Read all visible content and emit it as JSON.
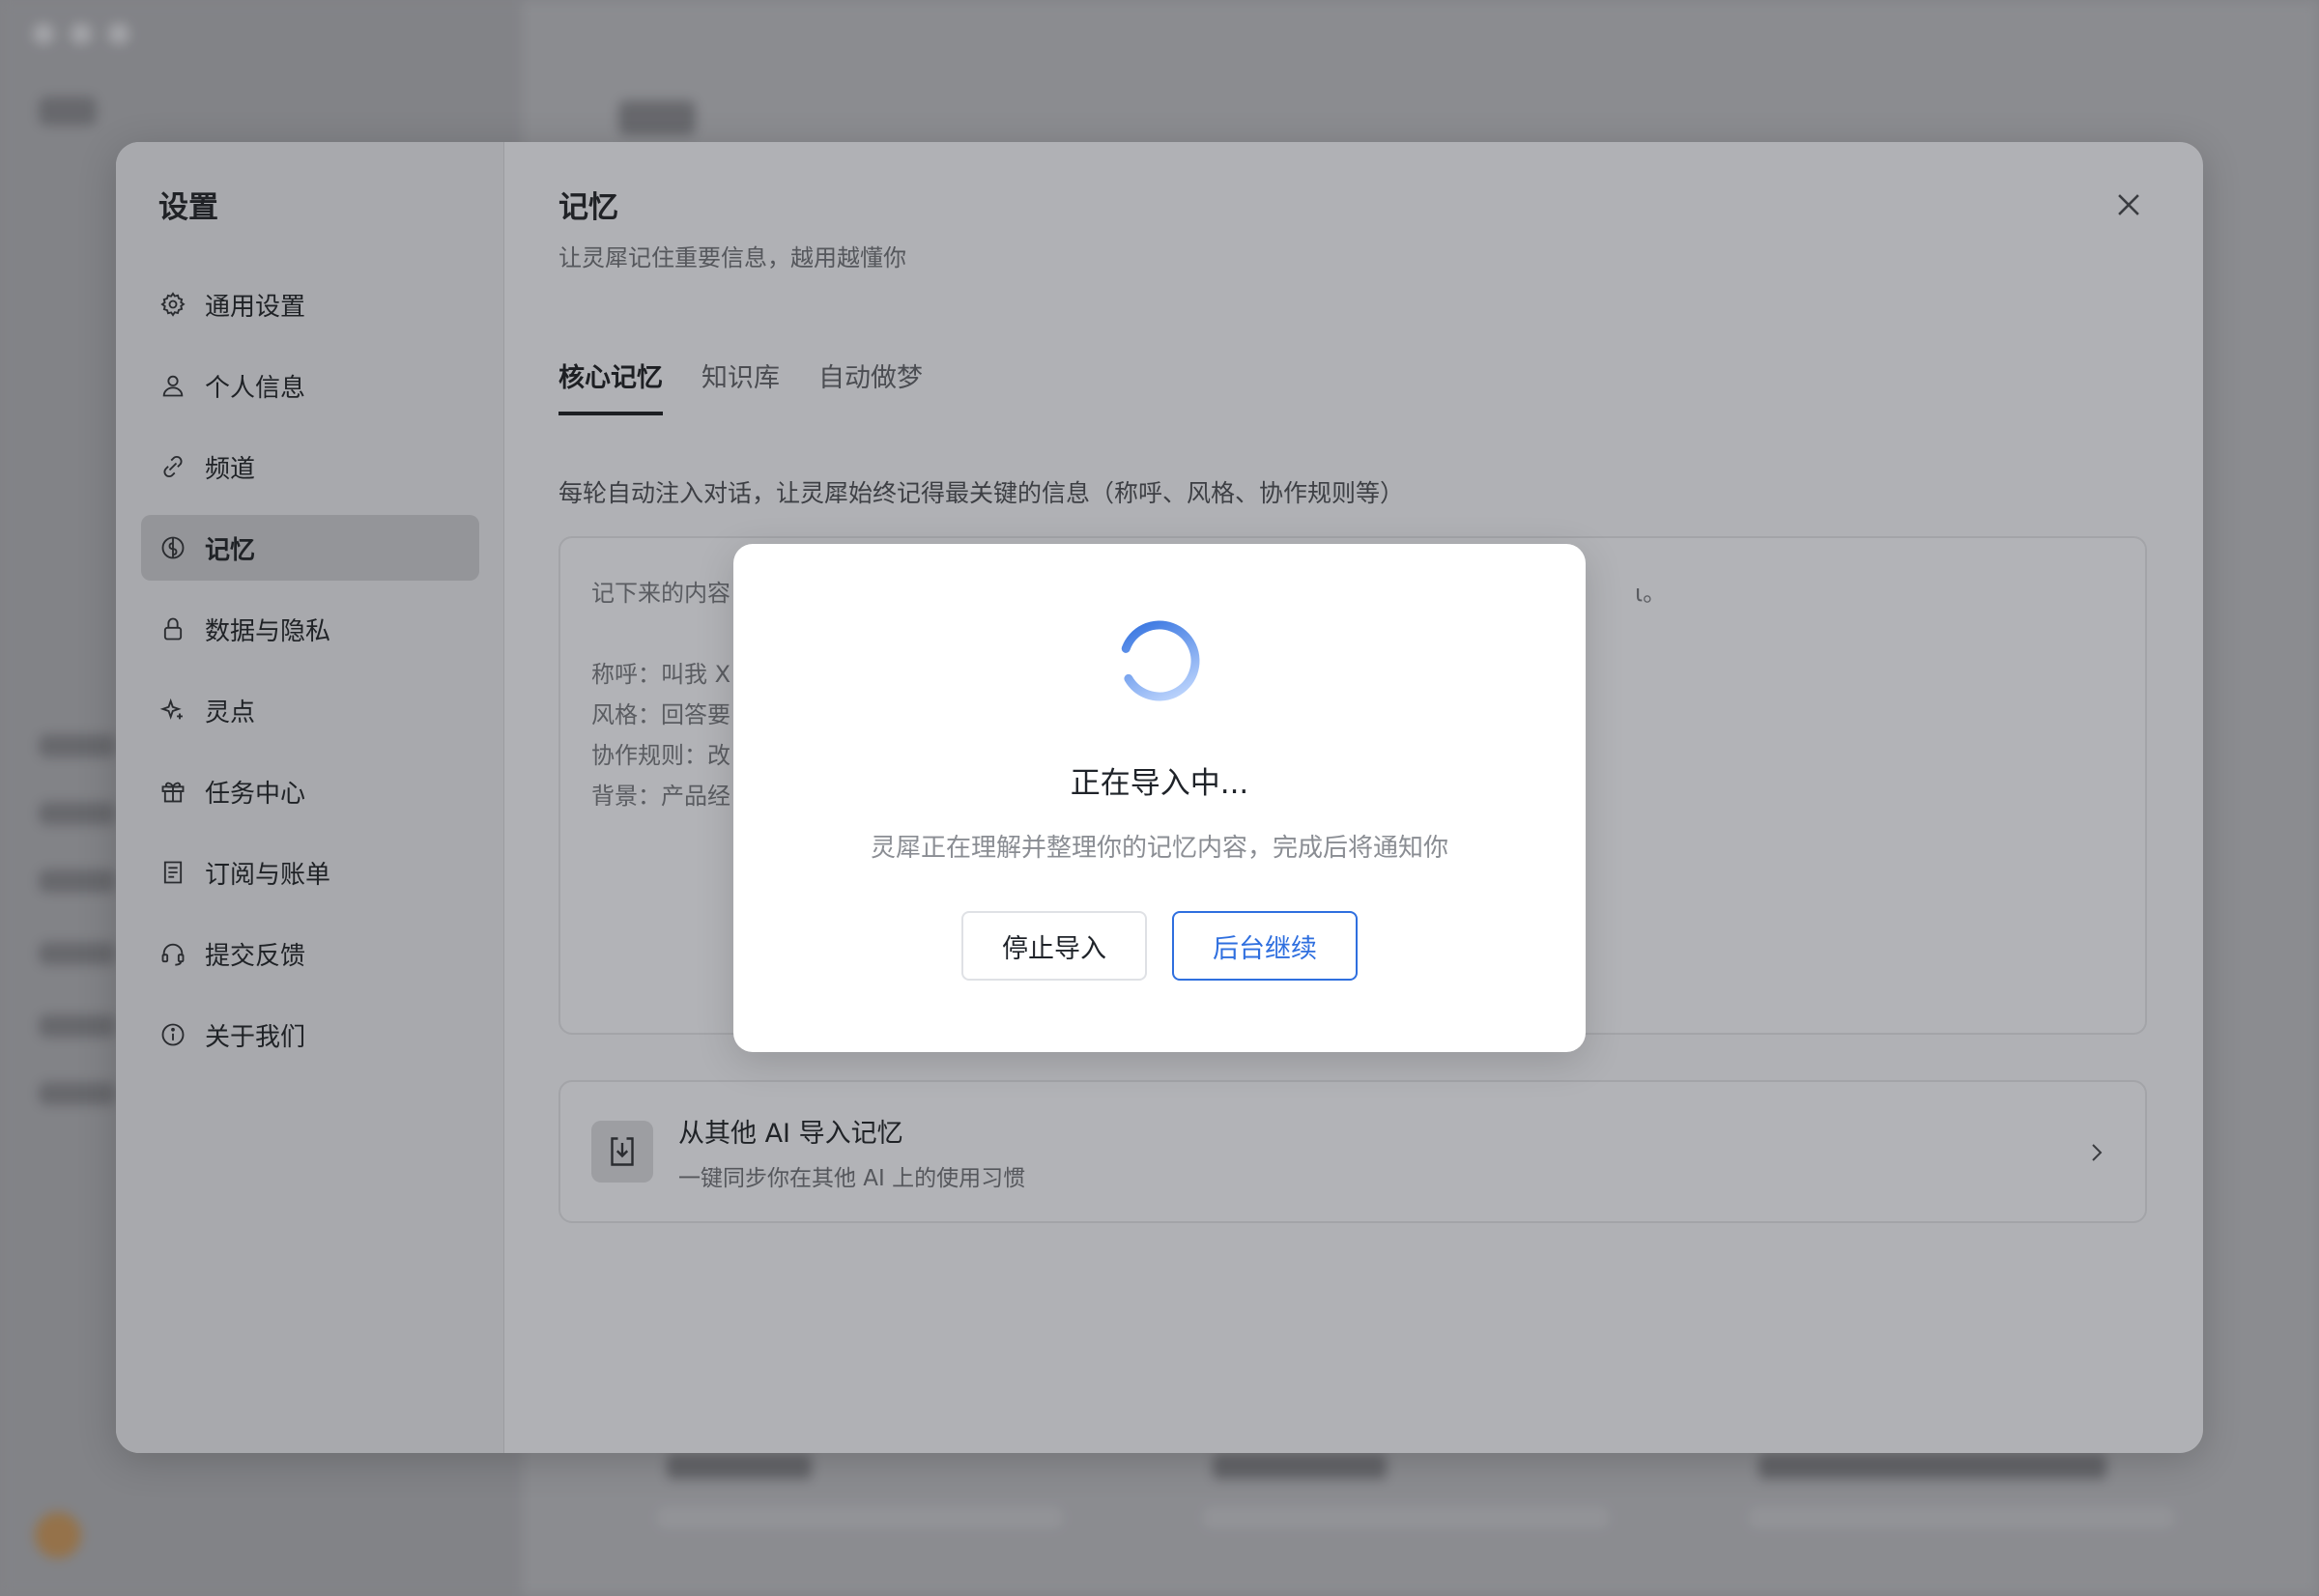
{
  "settings": {
    "title": "设置",
    "nav": [
      {
        "label": "通用设置",
        "icon": "gear-icon"
      },
      {
        "label": "个人信息",
        "icon": "user-icon"
      },
      {
        "label": "频道",
        "icon": "channel-icon"
      },
      {
        "label": "记忆",
        "icon": "brain-icon",
        "active": true
      },
      {
        "label": "数据与隐私",
        "icon": "lock-icon"
      },
      {
        "label": "灵点",
        "icon": "sparkle-icon"
      },
      {
        "label": "任务中心",
        "icon": "gift-icon"
      },
      {
        "label": "订阅与账单",
        "icon": "receipt-icon"
      },
      {
        "label": "提交反馈",
        "icon": "headset-icon"
      },
      {
        "label": "关于我们",
        "icon": "info-icon"
      }
    ]
  },
  "memory": {
    "title": "记忆",
    "subtitle": "让灵犀记住重要信息，越用越懂你",
    "tabs": [
      "核心记忆",
      "知识库",
      "自动做梦"
    ],
    "active_tab": "核心记忆",
    "description": "每轮自动注入对话，让灵犀始终记得最关键的信息（称呼、风格、协作规则等）",
    "box_lines": [
      "记下来的内容",
      "称呼：叫我 X",
      "风格：回答要",
      "协作规则：改",
      "背景：产品经"
    ],
    "box_line_suffix": "ι。",
    "import_card": {
      "title": "从其他 AI 导入记忆",
      "subtitle": "一键同步你在其他 AI 上的使用习惯"
    }
  },
  "dialog": {
    "title": "正在导入中...",
    "subtitle": "灵犀正在理解并整理你的记忆内容，完成后将通知你",
    "stop_label": "停止导入",
    "continue_label": "后台继续"
  },
  "colors": {
    "accent": "#2f6fdf",
    "spinner_start": "#c9ddff",
    "spinner_end": "#2f6fdf"
  }
}
